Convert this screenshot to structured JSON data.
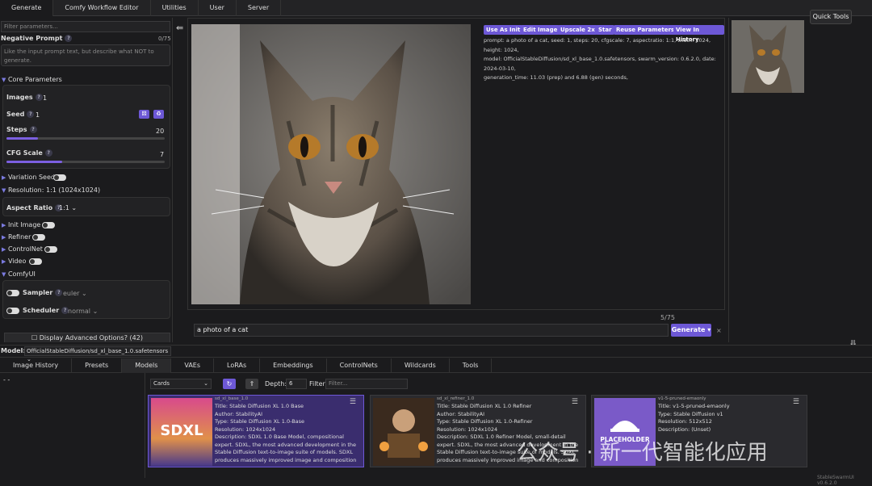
{
  "tabs": [
    "Generate",
    "Comfy Workflow Editor",
    "Utilities",
    "User",
    "Server"
  ],
  "quick_tools": "Quick Tools",
  "filter_placeholder": "Filter parameters...",
  "neg": {
    "label": "Negative Prompt",
    "count": "0/75",
    "placeholder": "Like the input prompt text, but describe what NOT to generate."
  },
  "core": {
    "label": "Core Parameters",
    "images_label": "Images",
    "images": "1",
    "seed_label": "Seed",
    "seed": "1",
    "steps_label": "Steps",
    "steps": "20",
    "steps_frac": 0.2,
    "cfg_label": "CFG Scale",
    "cfg": "7",
    "cfg_frac": 0.35
  },
  "variation_seed": "Variation Seed",
  "resolution": {
    "label": "Resolution: 1:1 (1024x1024)",
    "aspect_label": "Aspect Ratio",
    "aspect": "1:1"
  },
  "toggles": [
    "Init Image",
    "Refiner",
    "ControlNet",
    "Video"
  ],
  "comfyui": {
    "label": "ComfyUI",
    "sampler_label": "Sampler",
    "sampler": "euler",
    "scheduler_label": "Scheduler",
    "scheduler": "normal"
  },
  "advanced": "Display Advanced Options? (42)",
  "actions": [
    "Use As Init",
    "Edit Image",
    "Upscale 2x",
    "Star",
    "Reuse Parameters",
    "View In History"
  ],
  "meta": {
    "prompt": "a photo of a cat",
    "line1": "prompt: a photo of a cat, seed: 1, steps: 20, cfgscale: 7, aspectratio: 1:1, width: 1024, height: 1024,",
    "line2": "model: OfficialStableDiffusion/sd_xl_base_1.0.safetensors, swarm_version: 0.6.2.0, date: 2024-03-10,",
    "line3": "generation_time: 11.03 (prep) and 6.88 (gen) seconds,"
  },
  "prompt_count": "5/75",
  "prompt_value": "a photo of a cat",
  "generate": "Generate",
  "model": {
    "label": "Model:",
    "value": "OfficialStableDiffusion/sd_xl_base_1.0.safetensors"
  },
  "bottom_tabs": [
    "Image History",
    "Presets",
    "Models",
    "VAEs",
    "LoRAs",
    "Embeddings",
    "ControlNets",
    "Wildcards",
    "Tools"
  ],
  "browser": {
    "view": "Cards",
    "depth_label": "Depth:",
    "depth": "6",
    "filter_label": "Filter:",
    "filter_placeholder": "Filter...",
    "tree_root": "- -"
  },
  "cards": [
    {
      "file": "sd_xl_base_1.0",
      "title": "Title: Stable Diffusion XL 1.0 Base",
      "author": "Author: StabilityAI",
      "type": "Type: Stable Diffusion XL 1.0-Base",
      "res": "Resolution: 1024x1024",
      "desc": "Description: SDXL 1.0 Base Model, compositional expert. SDXL, the most advanced development in the Stable Diffusion text-to-image suite of models. SDXL produces massively improved image and composition detail over its predecessors. The ability to generate"
    },
    {
      "file": "sd_xl_refiner_1.0",
      "title": "Title: Stable Diffusion XL 1.0 Refiner",
      "author": "Author: StabilityAI",
      "type": "Type: Stable Diffusion XL 1.0-Refiner",
      "res": "Resolution: 1024x1024",
      "desc": "Description: SDXL 1.0 Refiner Model, small-detail expert. SDXL, the most advanced development in the Stable Diffusion text-to-image suite of models. SDXL produces massively improved image and composition detail over its predecessors. The ability to generate"
    },
    {
      "file": "v1-5-pruned-emaonly",
      "title": "Title: v1-5-pruned-emaonly",
      "author": "",
      "type": "Type: Stable Diffusion v1",
      "res": "Resolution: 512x512",
      "desc": "Description: (Unset)"
    }
  ],
  "placeholder_text": "PLACEHOLDER",
  "sdxl_text": "SDXL",
  "watermark": "公众号 · 新一代智能化应用",
  "version": "StableSwarmUI v0.6.2.0"
}
